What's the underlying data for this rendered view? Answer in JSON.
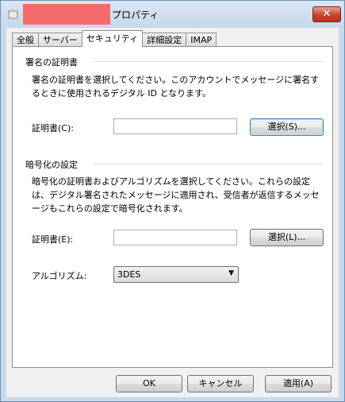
{
  "window": {
    "title": "プロパティ",
    "close_glyph": "✕"
  },
  "tabs": [
    {
      "label": "全般",
      "active": false
    },
    {
      "label": "サーバー",
      "active": false
    },
    {
      "label": "セキュリティ",
      "active": true
    },
    {
      "label": "詳細設定",
      "active": false
    },
    {
      "label": "IMAP",
      "active": false
    }
  ],
  "signing": {
    "heading": "署名の証明書",
    "description": "署名の証明書を選択してください。このアカウントでメッセージに署名するときに使用されるデジタル ID となります。",
    "cert_label": "証明書(C):",
    "cert_value": "",
    "select_button": "選択(S)..."
  },
  "encryption": {
    "heading": "暗号化の設定",
    "description": "暗号化の証明書およびアルゴリズムを選択してください。これらの設定は、デジタル署名されたメッセージに適用され、受信者が返信するメッセージもこれらの設定で暗号化されます。",
    "cert_label": "証明書(E):",
    "cert_value": "",
    "select_button": "選択(L)...",
    "algorithm_label": "アルゴリズム:",
    "algorithm_value": "3DES"
  },
  "footer": {
    "ok": "OK",
    "cancel": "キャンセル",
    "apply": "適用(A)"
  }
}
